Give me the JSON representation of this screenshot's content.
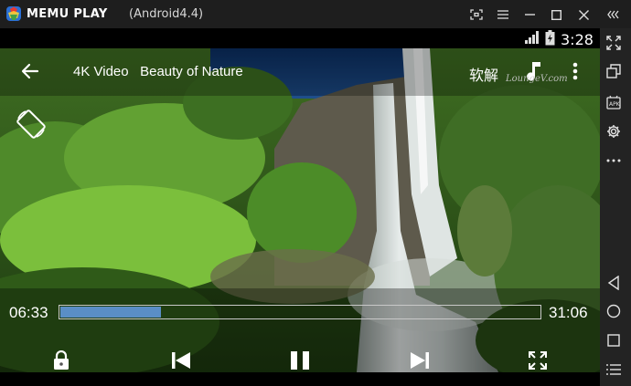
{
  "window": {
    "brand": "MEMU PLAY",
    "version": "(Android4.4)"
  },
  "status_bar": {
    "time": "3:28"
  },
  "player": {
    "title": "4K Video   Beauty of Nature",
    "subtitle_label": "软解",
    "watermark": "LoungeV.com",
    "current_time": "06:33",
    "total_time": "31:06",
    "progress": 0.21
  },
  "colors": {
    "progress_fill": "#5a8ec6",
    "titlebar_bg": "#1e1e1e",
    "sidebar_bg": "#232323"
  },
  "icons": {
    "titlebar": [
      "memu-logo-icon",
      "fullscreen-capture-icon",
      "menu-icon",
      "minimize-icon",
      "maximize-icon",
      "close-icon",
      "collapse-sidebar-icon"
    ],
    "sidebar": [
      "fullscreen-icon",
      "multi-window-icon",
      "apk-install-icon",
      "settings-icon",
      "more-icon",
      "back-nav-icon",
      "home-nav-icon",
      "recents-nav-icon",
      "list-menu-icon"
    ],
    "player": [
      "back-arrow-icon",
      "music-note-icon",
      "more-vertical-icon",
      "rotate-icon",
      "lock-icon",
      "skip-previous-icon",
      "pause-icon",
      "skip-next-icon",
      "fit-screen-icon"
    ]
  }
}
